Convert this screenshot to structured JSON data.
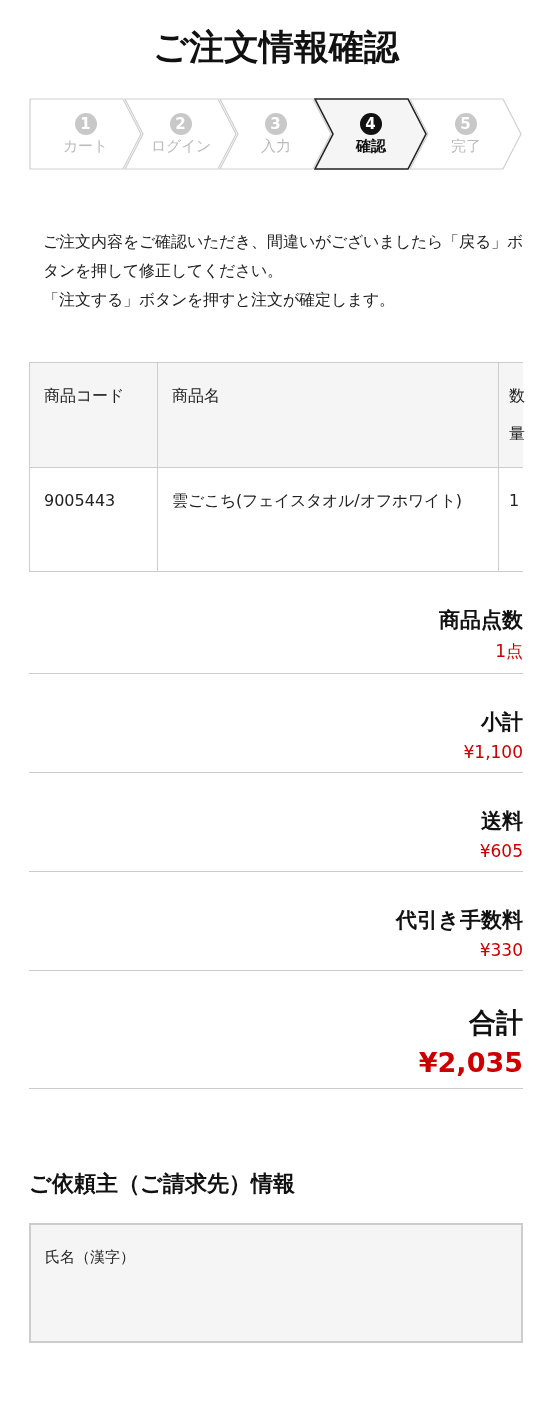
{
  "title": "ご注文情報確認",
  "steps": [
    {
      "number": "1",
      "label": "カート",
      "selected": false
    },
    {
      "number": "2",
      "label": "ログイン",
      "selected": false
    },
    {
      "number": "3",
      "label": "入力",
      "selected": false
    },
    {
      "number": "4",
      "label": "確認",
      "selected": true
    },
    {
      "number": "5",
      "label": "完了",
      "selected": false
    }
  ],
  "notice": [
    "ご注文内容をご確認いただき、間違いがございましたら「戻る」ボタンを押して修正してください。",
    "「注文する」ボタンを押すと注文が確定します。"
  ],
  "table": {
    "columns": [
      "商品コード",
      "商品名",
      "数量"
    ],
    "rows": [
      [
        "9005443",
        "雲ごこち(フェイスタオル/オフホワイト)",
        "1"
      ]
    ]
  },
  "summary": [
    {
      "kind": "item",
      "label": "商品点数",
      "value": "1点"
    },
    {
      "kind": "item",
      "label": "小計",
      "value": "¥1,100"
    },
    {
      "kind": "item",
      "label": "送料",
      "value": "¥605"
    },
    {
      "kind": "item",
      "label": "代引き手数料",
      "value": "¥330"
    },
    {
      "kind": "total",
      "label": "合計",
      "value": "¥2,035"
    }
  ],
  "billing": {
    "heading": "ご依頼主（ご請求先）情報",
    "fields": [
      {
        "label": "氏名（漢字）"
      }
    ]
  }
}
